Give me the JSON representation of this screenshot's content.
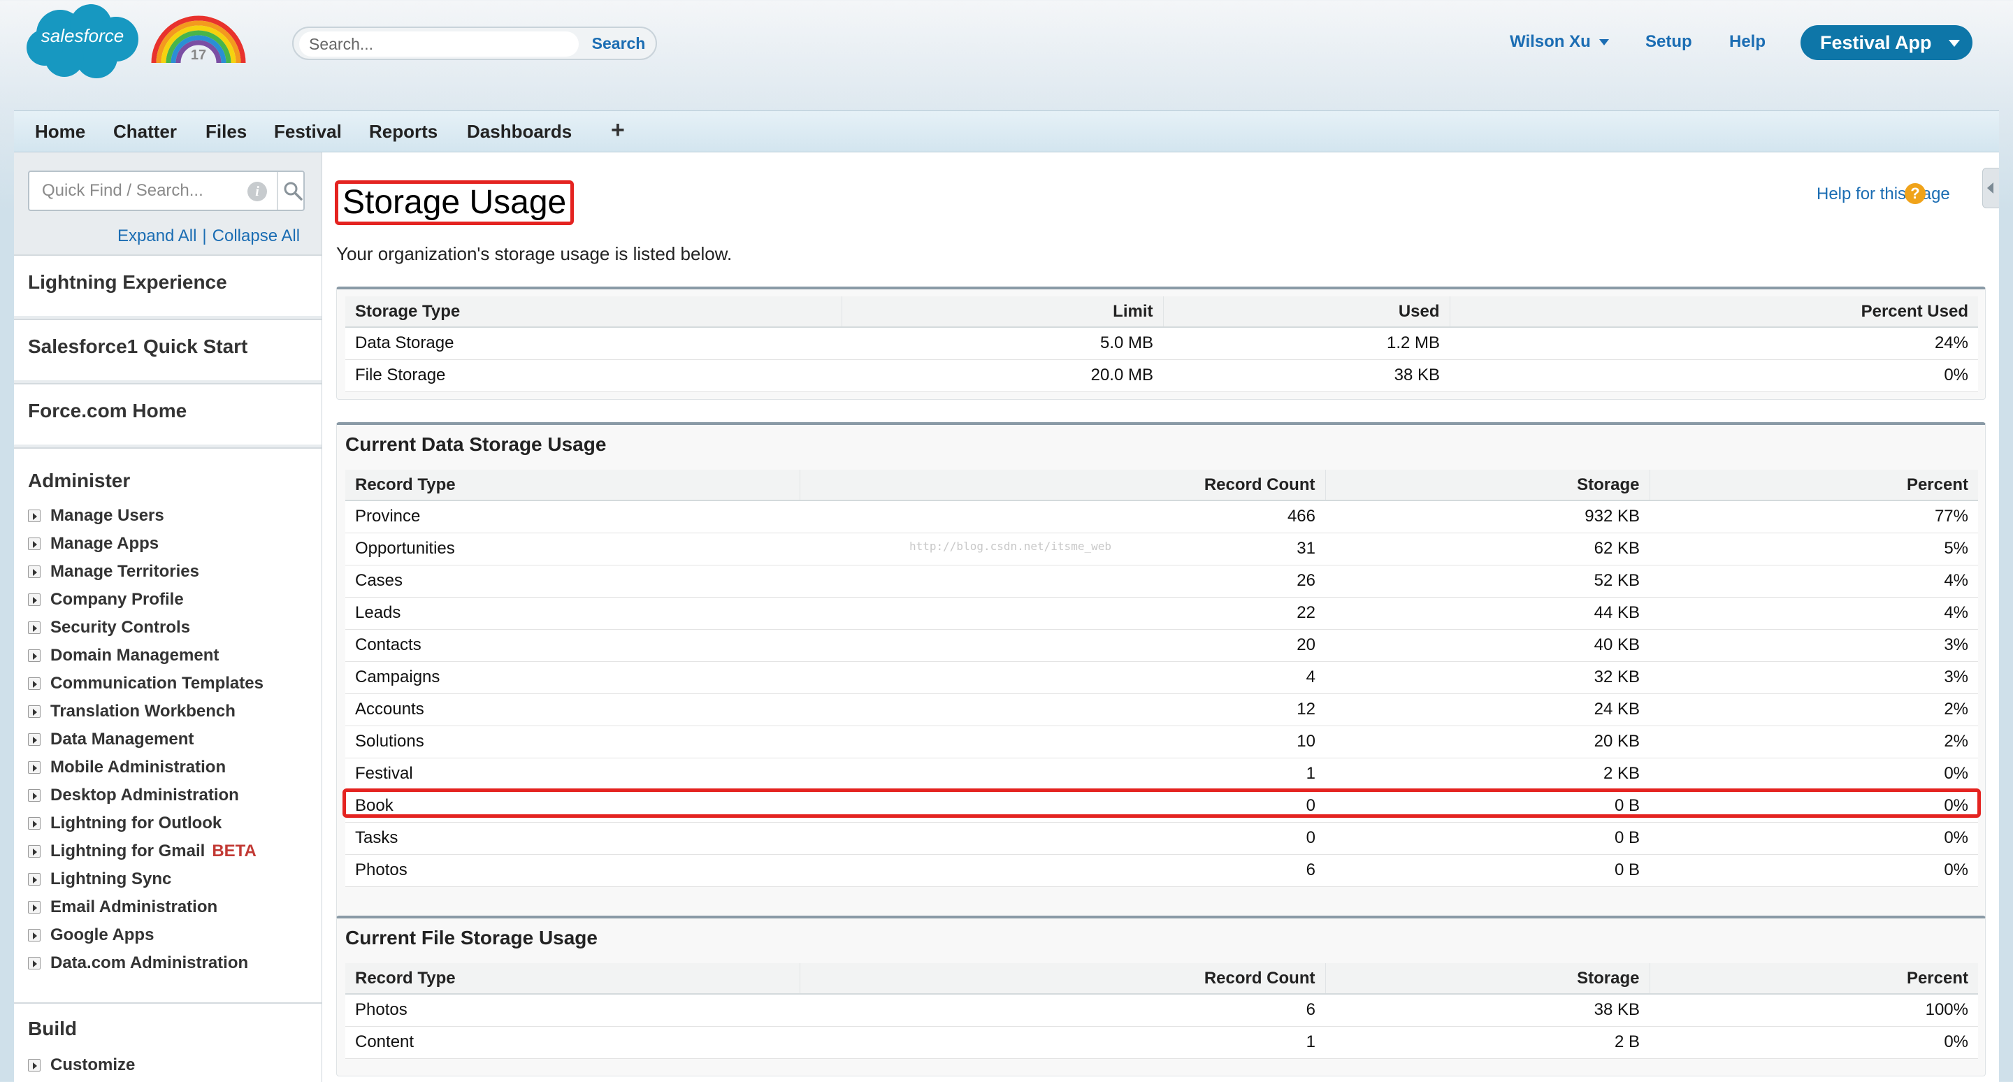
{
  "brand": {
    "logo_text": "salesforce",
    "rainbow_badge": "17",
    "colors": {
      "link": "#1b6db3",
      "brand": "#0e76a8",
      "highlight": "#e42320"
    }
  },
  "header": {
    "search_placeholder": "Search...",
    "search_button": "Search",
    "user_menu": "Wilson Xu",
    "setup": "Setup",
    "help": "Help",
    "app_menu": "Festival App"
  },
  "tabs": [
    "Home",
    "Chatter",
    "Files",
    "Festival",
    "Reports",
    "Dashboards"
  ],
  "tab_plus": "+",
  "sidebar": {
    "quick_find_placeholder": "Quick Find / Search...",
    "info_icon": "i",
    "expand_all": "Expand All",
    "separator": "|",
    "collapse_all": "Collapse All",
    "sections": [
      "Lightning Experience",
      "Salesforce1 Quick Start",
      "Force.com Home"
    ],
    "administer_title": "Administer",
    "administer_items": [
      "Manage Users",
      "Manage Apps",
      "Manage Territories",
      "Company Profile",
      "Security Controls",
      "Domain Management",
      "Communication Templates",
      "Translation Workbench",
      "Data Management",
      "Mobile Administration",
      "Desktop Administration",
      "Lightning for Outlook",
      "Lightning for Gmail",
      "Lightning Sync",
      "Email Administration",
      "Google Apps",
      "Data.com Administration"
    ],
    "beta_label": "BETA",
    "build_title": "Build",
    "build_items": [
      "Customize"
    ]
  },
  "main": {
    "title": "Storage Usage",
    "help_link": "Help for this Page",
    "help_icon": "?",
    "intro": "Your organization's storage usage is listed below.",
    "watermark": "http://blog.csdn.net/itsme_web",
    "summary": {
      "headers": [
        "Storage Type",
        "Limit",
        "Used",
        "Percent Used"
      ],
      "rows": [
        [
          "Data Storage",
          "5.0 MB",
          "1.2 MB",
          "24%"
        ],
        [
          "File Storage",
          "20.0 MB",
          "38 KB",
          "0%"
        ]
      ]
    },
    "data_storage": {
      "title": "Current Data Storage Usage",
      "headers": [
        "Record Type",
        "Record Count",
        "Storage",
        "Percent"
      ],
      "rows": [
        [
          "Province",
          "466",
          "932 KB",
          "77%"
        ],
        [
          "Opportunities",
          "31",
          "62 KB",
          "5%"
        ],
        [
          "Cases",
          "26",
          "52 KB",
          "4%"
        ],
        [
          "Leads",
          "22",
          "44 KB",
          "4%"
        ],
        [
          "Contacts",
          "20",
          "40 KB",
          "3%"
        ],
        [
          "Campaigns",
          "4",
          "32 KB",
          "3%"
        ],
        [
          "Accounts",
          "12",
          "24 KB",
          "2%"
        ],
        [
          "Solutions",
          "10",
          "20 KB",
          "2%"
        ],
        [
          "Festival",
          "1",
          "2 KB",
          "0%"
        ],
        [
          "Book",
          "0",
          "0 B",
          "0%"
        ],
        [
          "Tasks",
          "0",
          "0 B",
          "0%"
        ],
        [
          "Photos",
          "6",
          "0 B",
          "0%"
        ]
      ]
    },
    "file_storage": {
      "title": "Current File Storage Usage",
      "headers": [
        "Record Type",
        "Record Count",
        "Storage",
        "Percent"
      ],
      "rows": [
        [
          "Photos",
          "6",
          "38 KB",
          "100%"
        ],
        [
          "Content",
          "1",
          "2 B",
          "0%"
        ]
      ]
    }
  }
}
